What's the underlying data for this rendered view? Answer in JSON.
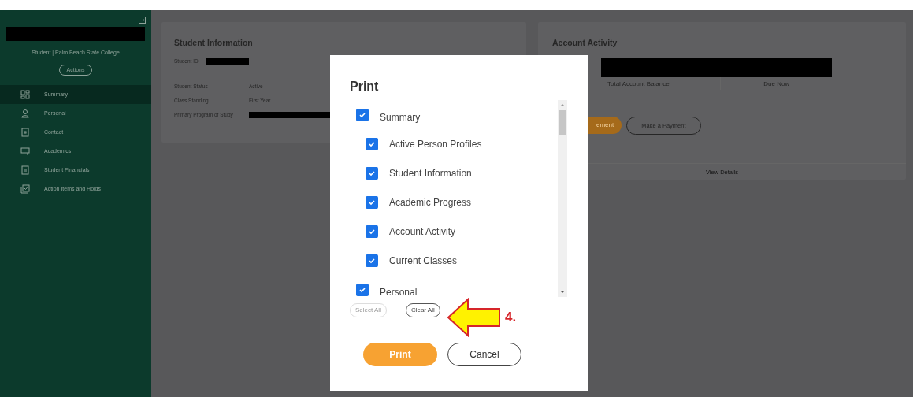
{
  "sidebar": {
    "subtitle": "Student | Palm Beach State College",
    "actions_button": "Actions",
    "items": [
      {
        "label": "Summary",
        "selected": true
      },
      {
        "label": "Personal",
        "selected": false
      },
      {
        "label": "Contact",
        "selected": false
      },
      {
        "label": "Academics",
        "selected": false
      },
      {
        "label": "Student Financials",
        "selected": false
      },
      {
        "label": "Action Items and Holds",
        "selected": false
      }
    ]
  },
  "student_information": {
    "title": "Student Information",
    "id_label": "Student ID",
    "fields": [
      {
        "label": "Student Status",
        "value": "Active"
      },
      {
        "label": "Class Standing",
        "value": "First Year"
      },
      {
        "label": "Primary Program of Study"
      }
    ]
  },
  "account_activity": {
    "title": "Account Activity",
    "columns": [
      "Total Account Balance",
      "Due Now"
    ],
    "orange_button": "ement",
    "payment_button": "Make a Payment",
    "footer_link": "View Details"
  },
  "print_dialog": {
    "title": "Print",
    "sections": [
      {
        "label": "Summary",
        "checked": true,
        "children": [
          {
            "label": "Active Person Profiles",
            "checked": true
          },
          {
            "label": "Student Information",
            "checked": true
          },
          {
            "label": "Academic Progress",
            "checked": true
          },
          {
            "label": "Account Activity",
            "checked": true
          },
          {
            "label": "Current Classes",
            "checked": true
          }
        ]
      },
      {
        "label": "Personal",
        "checked": true
      }
    ],
    "select_all": {
      "label": "Select All",
      "disabled": true
    },
    "clear_all": {
      "label": "Clear All",
      "disabled": false
    },
    "buttons": [
      "Print",
      "Cancel"
    ]
  },
  "annotation": {
    "label": "4."
  }
}
